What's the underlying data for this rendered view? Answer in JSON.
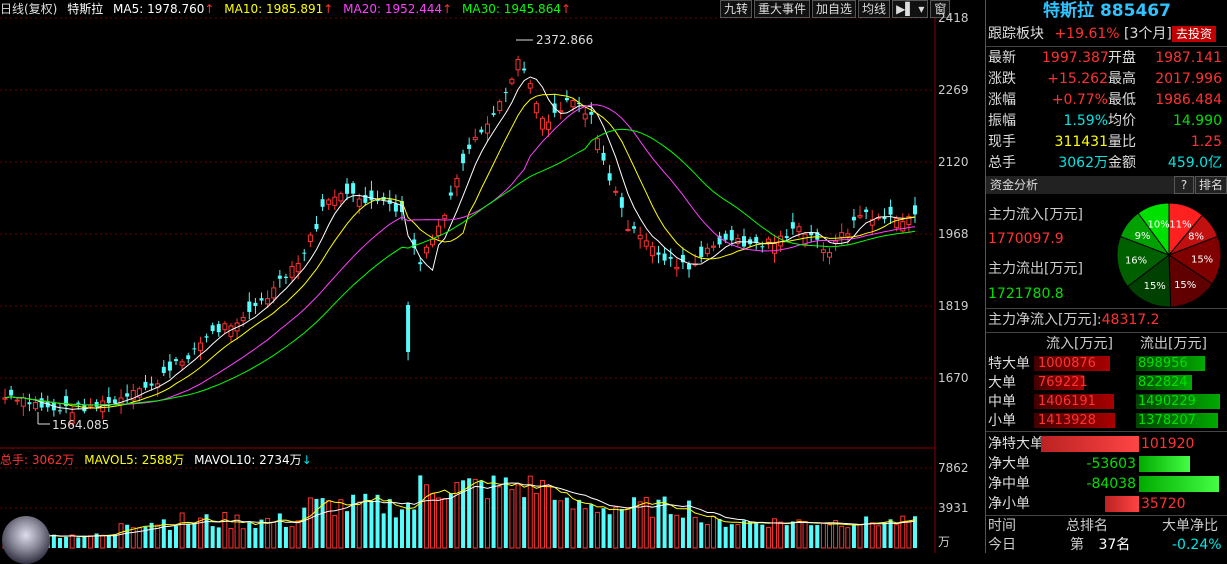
{
  "header": {
    "period": "日线(复权)",
    "name": "特斯拉",
    "ma5_label": "MA5:",
    "ma5": "1978.760",
    "ma10_label": "MA10:",
    "ma10": "1985.891",
    "ma20_label": "MA20:",
    "ma20": "1952.444",
    "ma30_label": "MA30:",
    "ma30": "1945.864",
    "up_arrow": "↑",
    "down_arrow": "↓"
  },
  "toolbar": [
    "九转",
    "重大事件",
    "加自选",
    "均线",
    "窗"
  ],
  "price_axis": [
    "2418",
    "2269",
    "2120",
    "1968",
    "1819",
    "1670"
  ],
  "annotations": {
    "high": "2372.866",
    "low": "1564.085"
  },
  "volume": {
    "total_label": "总手:",
    "total": "3062万",
    "mavol5_label": "MAVOL5:",
    "mavol5": "2588万",
    "mavol10_label": "MAVOL10:",
    "mavol10": "2734万",
    "axis": [
      "7862",
      "3931",
      "万"
    ]
  },
  "panel": {
    "title": "特斯拉 885467",
    "track_label": "跟踪板块",
    "track_value": "+19.61%",
    "track_period": "[3个月]",
    "track_button": "去投资",
    "quote": [
      {
        "l1": "最新",
        "v1": "1997.387",
        "l2": "开盘",
        "v2": "1987.141"
      },
      {
        "l1": "涨跌",
        "v1": "+15.262",
        "l2": "最高",
        "v2": "2017.996"
      },
      {
        "l1": "涨幅",
        "v1": "+0.77%",
        "l2": "最低",
        "v2": "1986.484"
      },
      {
        "l1": "振幅",
        "v1": "1.59%",
        "l2": "均价",
        "v2": "14.990"
      },
      {
        "l1": "现手",
        "v1": "311431",
        "l2": "量比",
        "v2": "1.25"
      },
      {
        "l1": "总手",
        "v1": "3062万",
        "l2": "金额",
        "v2": "459.0亿"
      }
    ],
    "fund_title": "资金分析",
    "fund_help": "?",
    "fund_rank": "排名",
    "inflow_label": "主力流入[万元]",
    "inflow_value": "1770097.9",
    "outflow_label": "主力流出[万元]",
    "outflow_value": "1721780.8",
    "net_label": "主力净流入[万元]:",
    "net_value": "48317.2",
    "pie": [
      {
        "pct": "11%",
        "color": "#ff2020"
      },
      {
        "pct": "8%",
        "color": "#c01010"
      },
      {
        "pct": "15%",
        "color": "#800000"
      },
      {
        "pct": "15%",
        "color": "#600000"
      },
      {
        "pct": "15%",
        "color": "#004000"
      },
      {
        "pct": "16%",
        "color": "#006000"
      },
      {
        "pct": "9%",
        "color": "#00a000"
      },
      {
        "pct": "10%",
        "color": "#00e000"
      }
    ],
    "flow_head_in": "流入[万元]",
    "flow_head_out": "流出[万元]",
    "flows": [
      {
        "name": "特大单",
        "in": "1000876",
        "out": "898956",
        "in_frac": 0.9,
        "out_frac": 0.8
      },
      {
        "name": "大单",
        "in": "769221",
        "out": "822824",
        "in_frac": 0.6,
        "out_frac": 0.65
      },
      {
        "name": "中单",
        "in": "1406191",
        "out": "1490229",
        "in_frac": 0.95,
        "out_frac": 0.98
      },
      {
        "name": "小单",
        "in": "1413928",
        "out": "1378207",
        "in_frac": 0.97,
        "out_frac": 0.95
      }
    ],
    "nets": [
      {
        "name": "净特大单",
        "value": "101920",
        "sign": "pos",
        "frac": 1.0
      },
      {
        "name": "净大单",
        "value": "-53603",
        "sign": "neg",
        "frac": 0.52
      },
      {
        "name": "净中单",
        "value": "-84038",
        "sign": "neg",
        "frac": 0.82
      },
      {
        "name": "净小单",
        "value": "35720",
        "sign": "pos",
        "frac": 0.35
      }
    ],
    "rank_head_time": "时间",
    "rank_head_rank": "总排名",
    "rank_head_net": "大单净比",
    "rank_time": "今日",
    "rank_prefix": "第",
    "rank_value": "37名",
    "rank_net": "-0.24%"
  }
}
